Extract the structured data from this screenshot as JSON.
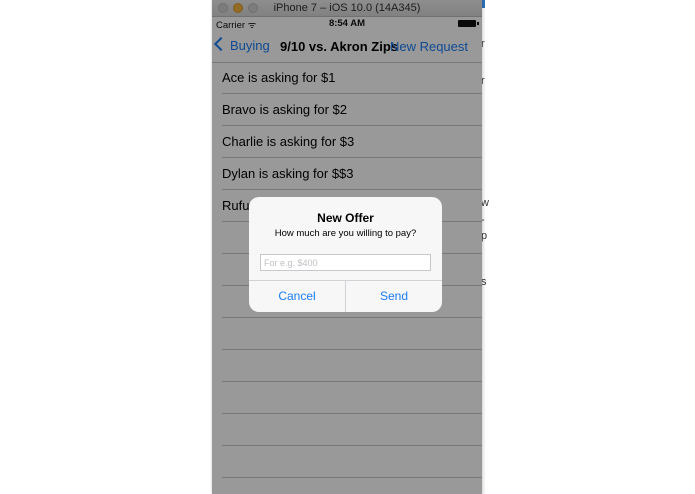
{
  "simulator": {
    "window_title": "iPhone 7 – iOS 10.0 (14A345)"
  },
  "status_bar": {
    "carrier": "Carrier ᯤ",
    "time": "8:54 AM"
  },
  "nav": {
    "back_label": "Buying",
    "title": "9/10 vs. Akron Zips",
    "right_label": "New Request"
  },
  "list": {
    "rows": [
      "Ace is asking for $1",
      "Bravo is asking for $2",
      "Charlie is asking for $3",
      "Dylan is asking for $$3",
      "Rufus",
      "",
      "",
      "",
      "",
      "",
      "",
      "",
      ""
    ]
  },
  "alert": {
    "title": "New Offer",
    "message": "How much are you willing to pay?",
    "input_placeholder": "For e.g. $400",
    "cancel_label": "Cancel",
    "send_label": "Send"
  },
  "background_fragments": [
    "r",
    "r",
    "w",
    "-",
    "p",
    "s"
  ],
  "colors": {
    "accent": "#1a7cf5",
    "dim_overlay": "rgba(0,0,0,0.4)"
  }
}
